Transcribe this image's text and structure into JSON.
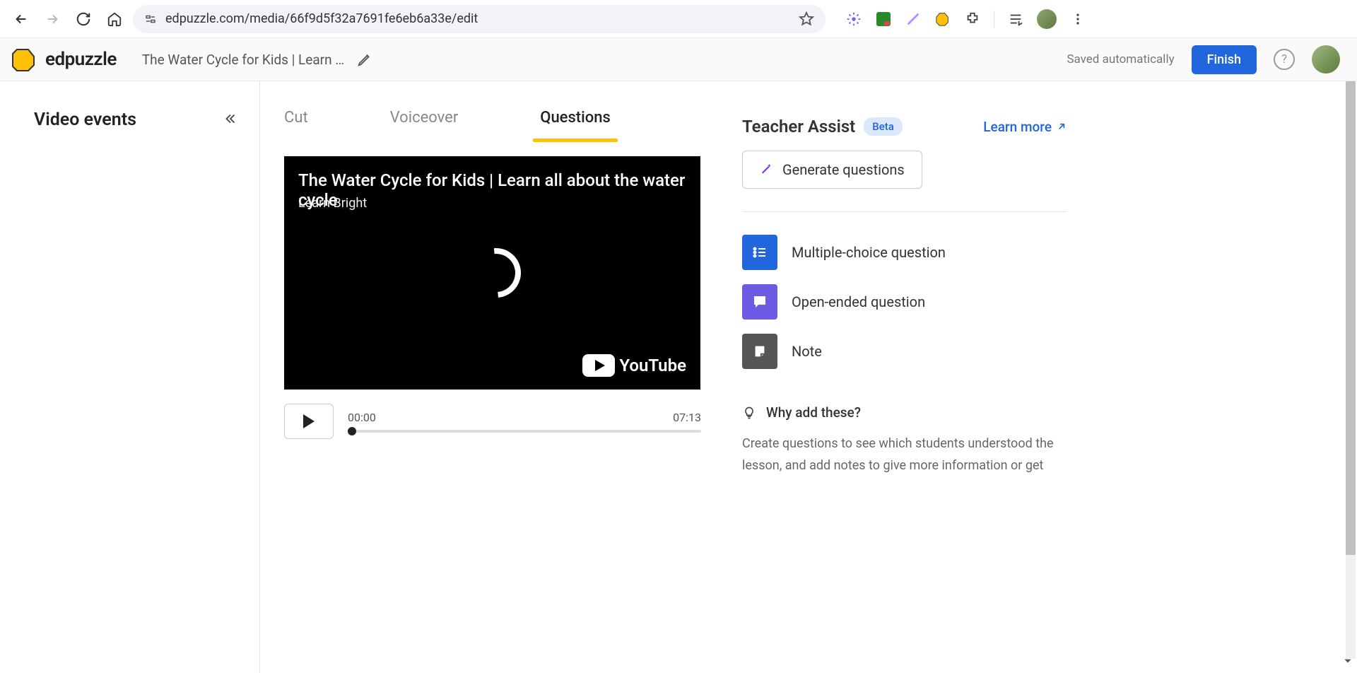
{
  "browser": {
    "url": "edpuzzle.com/media/66f9d5f32a7691fe6eb6a33e/edit"
  },
  "app": {
    "logo_text": "edpuzzle",
    "doc_title": "The Water Cycle for Kids | Learn …",
    "saved_status": "Saved automatically",
    "finish_label": "Finish"
  },
  "sidebar": {
    "title": "Video events"
  },
  "tabs": {
    "cut": "Cut",
    "voiceover": "Voiceover",
    "questions": "Questions"
  },
  "video": {
    "title": "The Water Cycle for Kids | Learn all about the water cycle",
    "channel": "Learn Bright",
    "youtube_label": "YouTube",
    "time_current": "00:00",
    "time_total": "07:13"
  },
  "assist": {
    "title": "Teacher Assist",
    "badge": "Beta",
    "learn_more": "Learn more",
    "generate": "Generate questions"
  },
  "question_types": {
    "mc": "Multiple-choice question",
    "oe": "Open-ended question",
    "note": "Note"
  },
  "why": {
    "heading": "Why add these?",
    "body": "Create questions to see which students understood the lesson, and add notes to give more information or get"
  }
}
